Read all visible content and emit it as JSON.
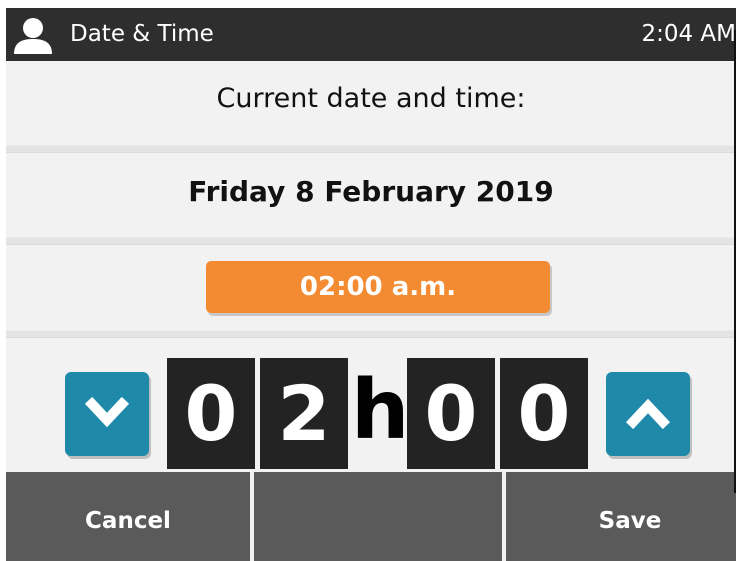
{
  "status_bar": {
    "icon": "user-icon",
    "title": "Date & Time",
    "clock": "2:04 AM"
  },
  "main": {
    "heading": "Current date and time:",
    "date": "Friday 8 February 2019",
    "time_display": "02:00  a.m."
  },
  "time_editor": {
    "decrement_icon": "chevron-down-icon",
    "increment_icon": "chevron-up-icon",
    "hour_digits": [
      "0",
      "2"
    ],
    "separator": "h",
    "minute_digits": [
      "0",
      "0"
    ]
  },
  "footer": {
    "cancel_label": "Cancel",
    "middle_label": "",
    "save_label": "Save"
  },
  "colors": {
    "accent_orange": "#f38b32",
    "stepper_blue": "#1e89a8",
    "bar_dark": "#2e2e2e",
    "footer_gray": "#5a5a5a"
  }
}
